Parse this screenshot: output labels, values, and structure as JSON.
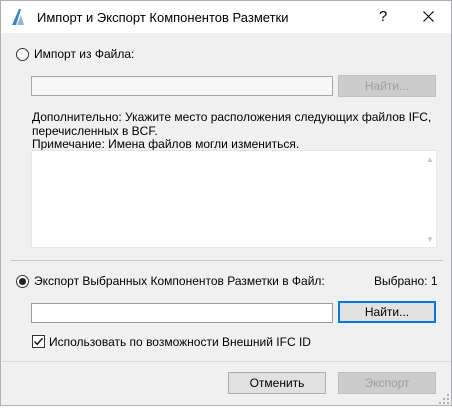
{
  "window": {
    "title": "Импорт и Экспорт Компонентов Разметки",
    "help_label": "?"
  },
  "import": {
    "radio_label": "Импорт из Файла:",
    "path_value": "",
    "browse_label": "Найти...",
    "note_line1": "Дополнительно: Укажите место расположения следующих файлов IFC,",
    "note_line2": "перечисленных в BCF.",
    "note_line3": "Примечание: Имена файлов могли измениться.",
    "files": []
  },
  "export": {
    "radio_label": "Экспорт Выбранных Компонентов Разметки в Файл:",
    "selected_label": "Выбрано: 1",
    "path_value": "",
    "browse_label": "Найти...",
    "checkbox_label": "Использовать по возможности Внешний IFC ID",
    "checkbox_checked": true
  },
  "footer": {
    "cancel_label": "Отменить",
    "export_label": "Экспорт"
  },
  "colors": {
    "default_button_border": "#0078d7",
    "disabled_text": "#9f9f9f",
    "app_icon": "#3b82c4"
  },
  "icons": [
    "archicad-icon",
    "help-icon",
    "close-icon",
    "scroll-up-icon",
    "scroll-down-icon",
    "checkmark-icon",
    "resize-grip-icon"
  ]
}
